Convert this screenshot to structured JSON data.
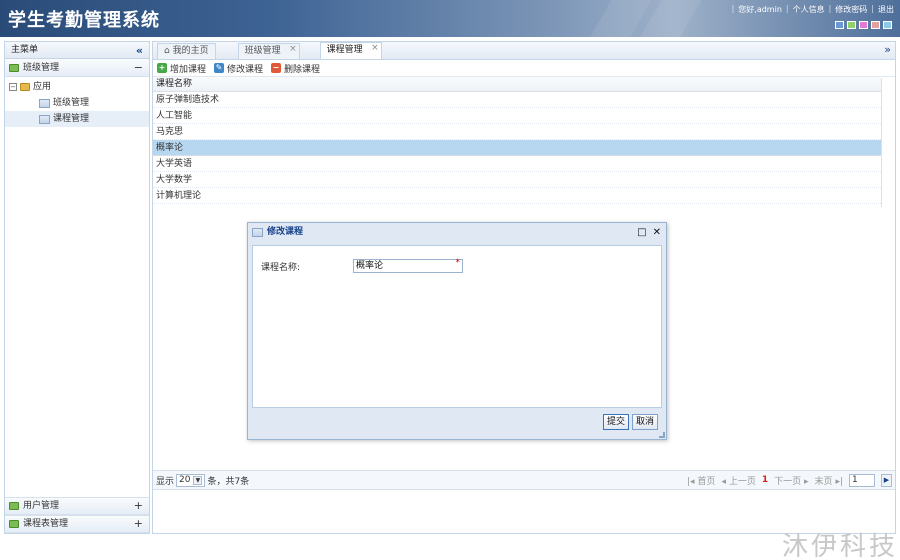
{
  "app": {
    "title": "学生考勤管理系统"
  },
  "top_links": {
    "greeting": "您好,admin",
    "profile": "个人信息",
    "change_password": "修改密码",
    "logout": "退出"
  },
  "theme_colors": [
    "#6a97d8",
    "#8fd06a",
    "#e07ad8",
    "#e2a0a0",
    "#8ccbe8"
  ],
  "sidebar": {
    "title": "主菜单",
    "collapse_icon": "double-left-arrow-icon",
    "groups": [
      {
        "label": "班级管理",
        "toggle": "−"
      },
      {
        "label": "用户管理",
        "toggle": "+"
      },
      {
        "label": "课程表管理",
        "toggle": "+"
      }
    ],
    "tree": {
      "root": "应用",
      "items": [
        {
          "label": "班级管理"
        },
        {
          "label": "课程管理"
        }
      ]
    }
  },
  "tabs": [
    {
      "label": "我的主页",
      "icon": "home-icon"
    },
    {
      "label": "班级管理",
      "close": "×"
    },
    {
      "label": "课程管理",
      "close": "×"
    }
  ],
  "tab_scroll_icon": "double-down-arrow-icon",
  "toolbar": {
    "add": "增加课程",
    "edit": "修改课程",
    "delete": "删除课程"
  },
  "grid": {
    "header": "课程名称",
    "rows": [
      "原子弹制造技术",
      "人工智能",
      "马克思",
      "概率论",
      "大学英语",
      "大学数学",
      "计算机理论"
    ],
    "selected_index": 3
  },
  "pager": {
    "show": "显示",
    "page_size": "20",
    "summary": "条，共7条",
    "first": "首页",
    "prev": "上一页",
    "current": "1",
    "next": "下一页",
    "last": "末页",
    "page_input": "1"
  },
  "dialog": {
    "title": "修改课程",
    "field_label": "课程名称:",
    "field_value": "概率论",
    "required_mark": "*",
    "submit": "提交",
    "cancel": "取消"
  },
  "watermark": "沐伊科技"
}
